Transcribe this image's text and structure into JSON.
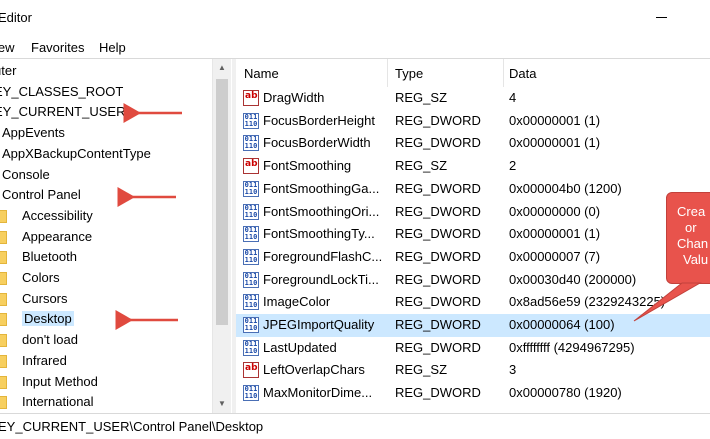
{
  "window": {
    "title": "Editor"
  },
  "menu": {
    "items": [
      {
        "label": "iew"
      },
      {
        "label": "Favorites"
      },
      {
        "label": "Help"
      }
    ]
  },
  "tree": {
    "items": [
      {
        "label": "uter",
        "indent": 0,
        "folder": false,
        "selected": false
      },
      {
        "label": "EY_CLASSES_ROOT",
        "indent": 0,
        "folder": false,
        "selected": false
      },
      {
        "label": "EY_CURRENT_USER",
        "indent": 0,
        "folder": false,
        "selected": false
      },
      {
        "label": "AppEvents",
        "indent": 1,
        "folder": false,
        "selected": false
      },
      {
        "label": "AppXBackupContentType",
        "indent": 1,
        "folder": false,
        "selected": false
      },
      {
        "label": "Console",
        "indent": 1,
        "folder": false,
        "selected": false
      },
      {
        "label": "Control Panel",
        "indent": 1,
        "folder": false,
        "selected": false
      },
      {
        "label": "Accessibility",
        "indent": 2,
        "folder": true,
        "selected": false
      },
      {
        "label": "Appearance",
        "indent": 2,
        "folder": true,
        "selected": false
      },
      {
        "label": "Bluetooth",
        "indent": 2,
        "folder": true,
        "selected": false
      },
      {
        "label": "Colors",
        "indent": 2,
        "folder": true,
        "selected": false
      },
      {
        "label": "Cursors",
        "indent": 2,
        "folder": true,
        "selected": false
      },
      {
        "label": "Desktop",
        "indent": 2,
        "folder": true,
        "selected": true
      },
      {
        "label": "don't load",
        "indent": 2,
        "folder": true,
        "selected": false
      },
      {
        "label": "Infrared",
        "indent": 2,
        "folder": true,
        "selected": false
      },
      {
        "label": "Input Method",
        "indent": 2,
        "folder": true,
        "selected": false
      },
      {
        "label": "International",
        "indent": 2,
        "folder": true,
        "selected": false
      }
    ]
  },
  "list": {
    "columns": [
      "Name",
      "Type",
      "Data"
    ],
    "rows": [
      {
        "icon": "string-value-icon",
        "name": "DragWidth",
        "type": "REG_SZ",
        "data": "4",
        "selected": false
      },
      {
        "icon": "dword-value-icon",
        "name": "FocusBorderHeight",
        "type": "REG_DWORD",
        "data": "0x00000001 (1)",
        "selected": false
      },
      {
        "icon": "dword-value-icon",
        "name": "FocusBorderWidth",
        "type": "REG_DWORD",
        "data": "0x00000001 (1)",
        "selected": false
      },
      {
        "icon": "string-value-icon",
        "name": "FontSmoothing",
        "type": "REG_SZ",
        "data": "2",
        "selected": false
      },
      {
        "icon": "dword-value-icon",
        "name": "FontSmoothingGa...",
        "type": "REG_DWORD",
        "data": "0x000004b0 (1200)",
        "selected": false
      },
      {
        "icon": "dword-value-icon",
        "name": "FontSmoothingOri...",
        "type": "REG_DWORD",
        "data": "0x00000000 (0)",
        "selected": false
      },
      {
        "icon": "dword-value-icon",
        "name": "FontSmoothingTy...",
        "type": "REG_DWORD",
        "data": "0x00000001 (1)",
        "selected": false
      },
      {
        "icon": "dword-value-icon",
        "name": "ForegroundFlashC...",
        "type": "REG_DWORD",
        "data": "0x00000007 (7)",
        "selected": false
      },
      {
        "icon": "dword-value-icon",
        "name": "ForegroundLockTi...",
        "type": "REG_DWORD",
        "data": "0x00030d40 (200000)",
        "selected": false
      },
      {
        "icon": "dword-value-icon",
        "name": "ImageColor",
        "type": "REG_DWORD",
        "data": "0x8ad56e59 (2329243225)",
        "selected": false
      },
      {
        "icon": "dword-value-icon",
        "name": "JPEGImportQuality",
        "type": "REG_DWORD",
        "data": "0x00000064 (100)",
        "selected": true
      },
      {
        "icon": "dword-value-icon",
        "name": "LastUpdated",
        "type": "REG_DWORD",
        "data": "0xffffffff (4294967295)",
        "selected": false
      },
      {
        "icon": "string-value-icon",
        "name": "LeftOverlapChars",
        "type": "REG_SZ",
        "data": "3",
        "selected": false
      },
      {
        "icon": "dword-value-icon",
        "name": "MaxMonitorDime...",
        "type": "REG_DWORD",
        "data": "0x00000780 (1920)",
        "selected": false
      }
    ]
  },
  "icons": {
    "string_glyph": "ab",
    "dword_glyph": "011 110"
  },
  "status": {
    "path": "EY_CURRENT_USER\\Control Panel\\Desktop"
  },
  "annotation": {
    "lines": [
      "Crea",
      "or",
      "Chan",
      "Valu"
    ],
    "color": "#e8534c"
  },
  "colors": {
    "selection": "#cce8ff",
    "arrow": "#e04a3f"
  }
}
